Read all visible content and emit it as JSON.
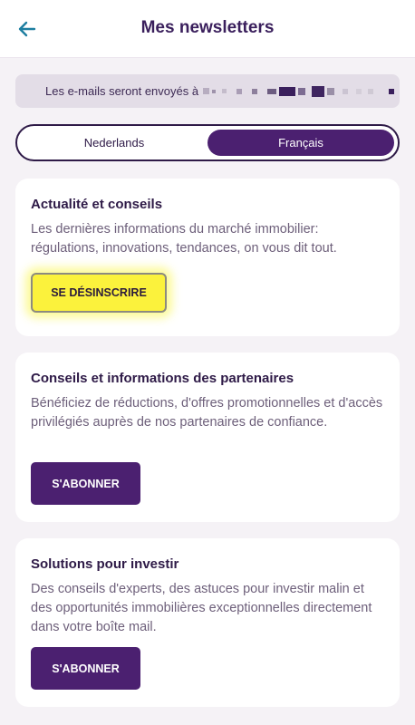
{
  "header": {
    "title": "Mes newsletters",
    "back_icon": "arrow-left-icon",
    "accent_color": "#1d7ea0"
  },
  "email_banner": {
    "text": "Les e-mails seront envoyés à",
    "masked": true
  },
  "language_toggle": {
    "options": [
      "Nederlands",
      "Français"
    ],
    "selected": "Français"
  },
  "newsletters": [
    {
      "title": "Actualité et conseils",
      "description": "Les dernières informations du marché immobilier: régulations, innovations, tendances, on vous dit tout.",
      "button_label": "SE DÉSINSCRIRE",
      "subscribed": true
    },
    {
      "title": "Conseils et informations des partenaires",
      "description": "Bénéficiez de réductions, d'offres promotionnelles et d'accès privilégiés auprès de nos partenaires de confiance.",
      "button_label": "S'ABONNER",
      "subscribed": false
    },
    {
      "title": "Solutions pour investir",
      "description": "Des conseils d'experts, des astuces pour investir malin et des opportunités immobilières exceptionnelles directement dans votre boîte mail.",
      "button_label": "S'ABONNER",
      "subscribed": false
    }
  ],
  "colors": {
    "primary": "#4b2070",
    "highlight": "#fbf23c",
    "background": "#f5f2f6"
  }
}
